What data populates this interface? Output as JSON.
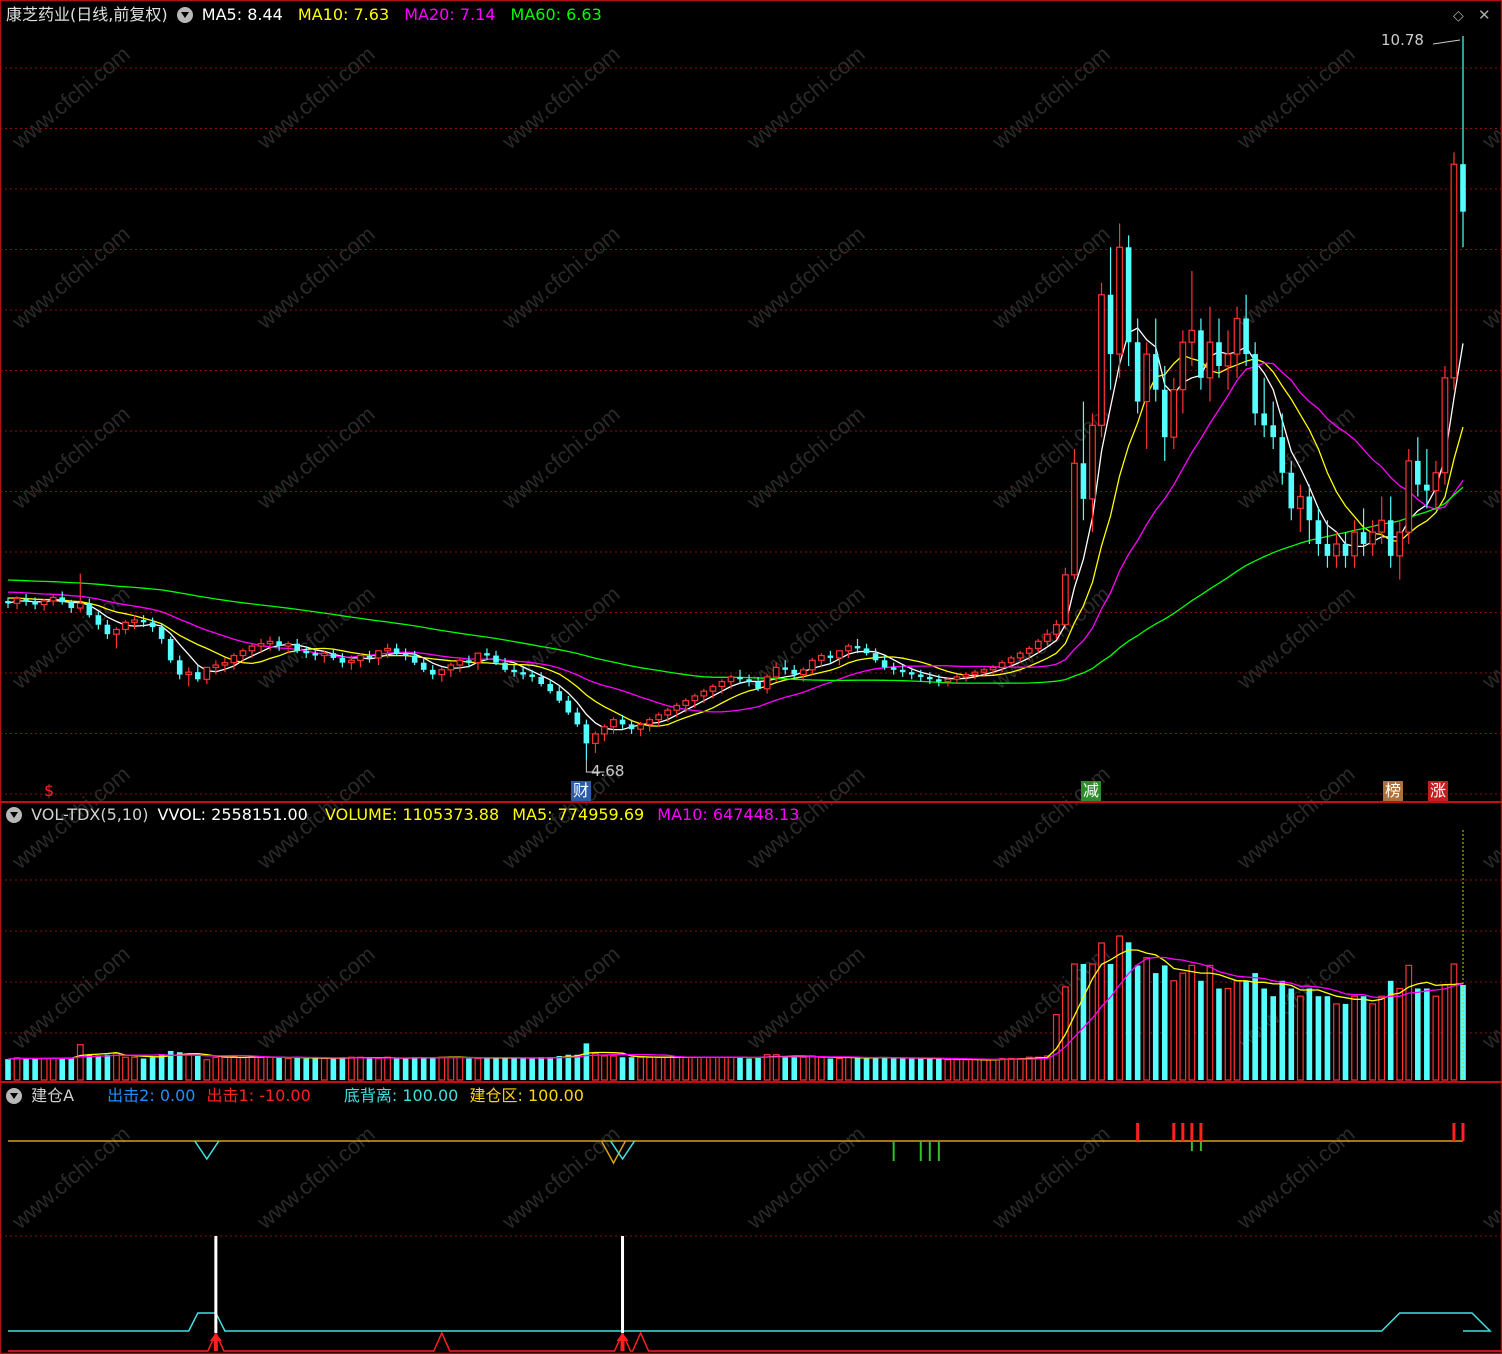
{
  "price_panel": {
    "title": "康芝药业(日线,前复权)",
    "ma": [
      {
        "label": "MA5:",
        "value": "8.44",
        "color": "#ffffff"
      },
      {
        "label": "MA10:",
        "value": "7.63",
        "color": "#ffff00"
      },
      {
        "label": "MA20:",
        "value": "7.14",
        "color": "#ff00ff"
      },
      {
        "label": "MA60:",
        "value": "6.63",
        "color": "#00ff00"
      }
    ],
    "high_label": "10.78",
    "low_label": "4.68",
    "event_badges": [
      {
        "text": "$",
        "color": "#ff2020",
        "bg": "none"
      },
      {
        "text": "财",
        "color": "#ffffff",
        "bg": "#2a5caa"
      },
      {
        "text": "减",
        "color": "#ffffff",
        "bg": "#2e8b2e"
      },
      {
        "text": "榜",
        "color": "#ffffff",
        "bg": "#b0703a"
      },
      {
        "text": "涨",
        "color": "#ffffff",
        "bg": "#c02020"
      }
    ]
  },
  "volume_panel": {
    "name": "VOL-TDX(5,10)",
    "items": [
      {
        "label": "VVOL:",
        "value": "2558151.00",
        "color": "#ffffff"
      },
      {
        "label": "VOLUME:",
        "value": "1105373.88",
        "color": "#ffff00"
      },
      {
        "label": "MA5:",
        "value": "774959.69",
        "color": "#ffff00"
      },
      {
        "label": "MA10:",
        "value": "647448.13",
        "color": "#ff00ff"
      }
    ]
  },
  "indicator_panel": {
    "name": "建仓A",
    "items": [
      {
        "label": "出击2:",
        "value": "0.00",
        "color": "#1e90ff"
      },
      {
        "label": "出击1:",
        "value": "-10.00",
        "color": "#ff2020"
      },
      {
        "label": "底背离:",
        "value": "100.00",
        "color": "#40e0e0"
      },
      {
        "label": "建仓区:",
        "value": "100.00",
        "color": "#ffd700"
      }
    ]
  },
  "watermark": "www.cfchi.com",
  "chart_data": {
    "type": "candlestick",
    "price_axis": {
      "min": 4.68,
      "max": 10.78
    },
    "candles": [
      [
        6.02,
        6.05,
        5.96,
        6.0
      ],
      [
        6.0,
        6.06,
        5.95,
        6.04
      ],
      [
        6.04,
        6.08,
        5.98,
        6.02
      ],
      [
        6.02,
        6.05,
        5.95,
        5.99
      ],
      [
        5.99,
        6.04,
        5.94,
        6.02
      ],
      [
        6.02,
        6.08,
        5.98,
        6.05
      ],
      [
        6.05,
        6.1,
        5.99,
        6.01
      ],
      [
        6.01,
        6.03,
        5.92,
        5.96
      ],
      [
        5.96,
        6.25,
        5.93,
        6.0
      ],
      [
        6.0,
        6.04,
        5.88,
        5.9
      ],
      [
        5.9,
        5.93,
        5.78,
        5.82
      ],
      [
        5.82,
        5.86,
        5.7,
        5.74
      ],
      [
        5.74,
        5.8,
        5.62,
        5.78
      ],
      [
        5.78,
        5.86,
        5.74,
        5.84
      ],
      [
        5.84,
        5.9,
        5.78,
        5.86
      ],
      [
        5.86,
        5.9,
        5.8,
        5.84
      ],
      [
        5.84,
        5.88,
        5.76,
        5.8
      ],
      [
        5.8,
        5.83,
        5.66,
        5.7
      ],
      [
        5.7,
        5.72,
        5.5,
        5.52
      ],
      [
        5.52,
        5.56,
        5.36,
        5.4
      ],
      [
        5.4,
        5.46,
        5.3,
        5.42
      ],
      [
        5.42,
        5.48,
        5.34,
        5.36
      ],
      [
        5.36,
        5.4,
        5.32,
        5.46
      ],
      [
        5.46,
        5.52,
        5.4,
        5.48
      ],
      [
        5.48,
        5.54,
        5.42,
        5.5
      ],
      [
        5.5,
        5.58,
        5.44,
        5.56
      ],
      [
        5.56,
        5.62,
        5.5,
        5.6
      ],
      [
        5.6,
        5.66,
        5.54,
        5.64
      ],
      [
        5.64,
        5.7,
        5.58,
        5.66
      ],
      [
        5.66,
        5.72,
        5.6,
        5.68
      ],
      [
        5.68,
        5.72,
        5.6,
        5.64
      ],
      [
        5.64,
        5.68,
        5.58,
        5.66
      ],
      [
        5.66,
        5.7,
        5.58,
        5.6
      ],
      [
        5.6,
        5.64,
        5.54,
        5.58
      ],
      [
        5.58,
        5.62,
        5.52,
        5.56
      ],
      [
        5.56,
        5.6,
        5.5,
        5.58
      ],
      [
        5.58,
        5.62,
        5.52,
        5.54
      ],
      [
        5.54,
        5.58,
        5.46,
        5.5
      ],
      [
        5.5,
        5.56,
        5.44,
        5.52
      ],
      [
        5.52,
        5.58,
        5.46,
        5.56
      ],
      [
        5.56,
        5.6,
        5.5,
        5.54
      ],
      [
        5.54,
        5.58,
        5.48,
        5.6
      ],
      [
        5.6,
        5.66,
        5.54,
        5.62
      ],
      [
        5.62,
        5.66,
        5.56,
        5.58
      ],
      [
        5.58,
        5.62,
        5.52,
        5.56
      ],
      [
        5.56,
        5.6,
        5.48,
        5.5
      ],
      [
        5.5,
        5.54,
        5.42,
        5.44
      ],
      [
        5.44,
        5.48,
        5.36,
        5.4
      ],
      [
        5.4,
        5.46,
        5.34,
        5.44
      ],
      [
        5.44,
        5.5,
        5.38,
        5.48
      ],
      [
        5.48,
        5.54,
        5.42,
        5.52
      ],
      [
        5.52,
        5.56,
        5.46,
        5.5
      ],
      [
        5.5,
        5.54,
        5.44,
        5.58
      ],
      [
        5.58,
        5.62,
        5.52,
        5.56
      ],
      [
        5.56,
        5.6,
        5.48,
        5.5
      ],
      [
        5.5,
        5.54,
        5.42,
        5.44
      ],
      [
        5.44,
        5.48,
        5.38,
        5.42
      ],
      [
        5.42,
        5.46,
        5.36,
        5.4
      ],
      [
        5.4,
        5.44,
        5.34,
        5.38
      ],
      [
        5.38,
        5.42,
        5.3,
        5.32
      ],
      [
        5.32,
        5.36,
        5.24,
        5.26
      ],
      [
        5.26,
        5.3,
        5.16,
        5.18
      ],
      [
        5.18,
        5.22,
        5.06,
        5.08
      ],
      [
        5.08,
        5.12,
        4.96,
        4.98
      ],
      [
        4.98,
        5.02,
        4.68,
        4.82
      ],
      [
        4.82,
        4.92,
        4.74,
        4.9
      ],
      [
        4.9,
        4.98,
        4.84,
        4.96
      ],
      [
        4.96,
        5.04,
        4.9,
        5.02
      ],
      [
        5.02,
        5.06,
        4.94,
        4.98
      ],
      [
        4.98,
        5.02,
        4.9,
        4.94
      ],
      [
        4.94,
        5.0,
        4.88,
        4.98
      ],
      [
        4.98,
        5.04,
        4.92,
        5.02
      ],
      [
        5.02,
        5.08,
        4.96,
        5.06
      ],
      [
        5.06,
        5.12,
        5.0,
        5.1
      ],
      [
        5.1,
        5.16,
        5.04,
        5.14
      ],
      [
        5.14,
        5.2,
        5.08,
        5.18
      ],
      [
        5.18,
        5.24,
        5.12,
        5.22
      ],
      [
        5.22,
        5.28,
        5.16,
        5.26
      ],
      [
        5.26,
        5.32,
        5.2,
        5.3
      ],
      [
        5.3,
        5.36,
        5.24,
        5.34
      ],
      [
        5.34,
        5.4,
        5.28,
        5.38
      ],
      [
        5.38,
        5.44,
        5.32,
        5.36
      ],
      [
        5.36,
        5.4,
        5.3,
        5.34
      ],
      [
        5.34,
        5.38,
        5.26,
        5.28
      ],
      [
        5.28,
        5.4,
        5.24,
        5.38
      ],
      [
        5.38,
        5.5,
        5.34,
        5.46
      ],
      [
        5.46,
        5.52,
        5.4,
        5.44
      ],
      [
        5.44,
        5.48,
        5.36,
        5.4
      ],
      [
        5.4,
        5.46,
        5.34,
        5.44
      ],
      [
        5.44,
        5.54,
        5.4,
        5.52
      ],
      [
        5.52,
        5.58,
        5.46,
        5.56
      ],
      [
        5.56,
        5.6,
        5.5,
        5.54
      ],
      [
        5.54,
        5.58,
        5.48,
        5.6
      ],
      [
        5.6,
        5.66,
        5.54,
        5.64
      ],
      [
        5.64,
        5.7,
        5.58,
        5.62
      ],
      [
        5.62,
        5.66,
        5.56,
        5.58
      ],
      [
        5.58,
        5.62,
        5.5,
        5.52
      ],
      [
        5.52,
        5.56,
        5.44,
        5.46
      ],
      [
        5.46,
        5.5,
        5.4,
        5.44
      ],
      [
        5.44,
        5.48,
        5.38,
        5.42
      ],
      [
        5.42,
        5.46,
        5.36,
        5.4
      ],
      [
        5.4,
        5.44,
        5.34,
        5.38
      ],
      [
        5.38,
        5.42,
        5.32,
        5.36
      ],
      [
        5.36,
        5.4,
        5.3,
        5.34
      ],
      [
        5.34,
        5.38,
        5.3,
        5.36
      ],
      [
        5.36,
        5.4,
        5.32,
        5.38
      ],
      [
        5.38,
        5.42,
        5.34,
        5.4
      ],
      [
        5.4,
        5.44,
        5.36,
        5.42
      ],
      [
        5.42,
        5.46,
        5.38,
        5.44
      ],
      [
        5.44,
        5.48,
        5.4,
        5.46
      ],
      [
        5.46,
        5.52,
        5.42,
        5.5
      ],
      [
        5.5,
        5.56,
        5.46,
        5.54
      ],
      [
        5.54,
        5.6,
        5.5,
        5.58
      ],
      [
        5.58,
        5.64,
        5.52,
        5.62
      ],
      [
        5.62,
        5.7,
        5.58,
        5.68
      ],
      [
        5.68,
        5.78,
        5.64,
        5.74
      ],
      [
        5.74,
        5.86,
        5.7,
        5.82
      ],
      [
        5.82,
        6.3,
        5.78,
        6.24
      ],
      [
        6.24,
        7.3,
        6.2,
        7.18
      ],
      [
        7.18,
        7.7,
        6.7,
        6.88
      ],
      [
        6.88,
        7.6,
        6.6,
        7.5
      ],
      [
        7.5,
        8.7,
        7.4,
        8.6
      ],
      [
        8.6,
        9.0,
        7.8,
        8.1
      ],
      [
        8.1,
        9.2,
        7.9,
        9.0
      ],
      [
        9.0,
        9.1,
        8.0,
        8.2
      ],
      [
        8.2,
        8.4,
        7.6,
        7.7
      ],
      [
        7.7,
        8.2,
        7.3,
        8.1
      ],
      [
        8.1,
        8.4,
        7.7,
        7.8
      ],
      [
        7.8,
        8.0,
        7.2,
        7.4
      ],
      [
        7.4,
        7.9,
        7.3,
        7.8
      ],
      [
        7.8,
        8.3,
        7.6,
        8.2
      ],
      [
        8.2,
        8.8,
        8.0,
        8.3
      ],
      [
        8.3,
        8.4,
        7.8,
        7.9
      ],
      [
        7.9,
        8.5,
        7.7,
        8.2
      ],
      [
        8.2,
        8.4,
        7.9,
        8.0
      ],
      [
        8.0,
        8.3,
        7.8,
        8.1
      ],
      [
        8.1,
        8.5,
        7.9,
        8.4
      ],
      [
        8.4,
        8.6,
        8.0,
        8.1
      ],
      [
        8.1,
        8.2,
        7.5,
        7.6
      ],
      [
        7.6,
        7.9,
        7.4,
        7.5
      ],
      [
        7.5,
        7.7,
        7.3,
        7.4
      ],
      [
        7.4,
        7.6,
        7.0,
        7.1
      ],
      [
        7.1,
        7.2,
        6.7,
        6.8
      ],
      [
        6.8,
        7.0,
        6.6,
        6.9
      ],
      [
        6.9,
        7.0,
        6.5,
        6.7
      ],
      [
        6.7,
        6.8,
        6.4,
        6.5
      ],
      [
        6.5,
        6.7,
        6.3,
        6.4
      ],
      [
        6.4,
        6.6,
        6.3,
        6.5
      ],
      [
        6.5,
        6.6,
        6.3,
        6.4
      ],
      [
        6.4,
        6.7,
        6.3,
        6.6
      ],
      [
        6.6,
        6.8,
        6.4,
        6.5
      ],
      [
        6.5,
        6.7,
        6.4,
        6.6
      ],
      [
        6.6,
        6.9,
        6.5,
        6.7
      ],
      [
        6.7,
        6.9,
        6.3,
        6.4
      ],
      [
        6.4,
        6.7,
        6.2,
        6.6
      ],
      [
        6.6,
        7.3,
        6.5,
        7.2
      ],
      [
        7.2,
        7.4,
        6.9,
        7.0
      ],
      [
        7.0,
        7.3,
        6.8,
        6.95
      ],
      [
        6.95,
        7.2,
        6.8,
        7.1
      ],
      [
        7.1,
        8.0,
        7.0,
        7.9
      ],
      [
        7.9,
        9.8,
        7.8,
        9.7
      ],
      [
        9.7,
        10.78,
        9.0,
        9.3
      ]
    ],
    "ma_lines": [
      "MA5",
      "MA10",
      "MA20",
      "MA60"
    ],
    "volume_series": [
      "VOLUME",
      "MA5",
      "MA10"
    ]
  }
}
